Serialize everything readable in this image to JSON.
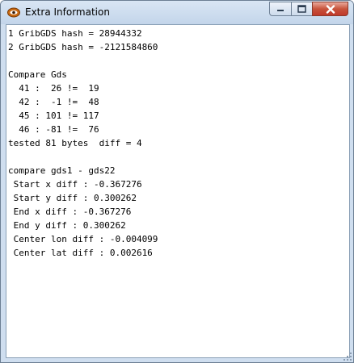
{
  "window": {
    "title": "Extra Information"
  },
  "log_lines": [
    "1 GribGDS hash = 28944332",
    "2 GribGDS hash = -2121584860",
    "",
    "Compare Gds",
    "  41 :  26 !=  19",
    "  42 :  -1 !=  48",
    "  45 : 101 != 117",
    "  46 : -81 !=  76",
    "tested 81 bytes  diff = 4",
    "",
    "compare gds1 - gds22",
    " Start x diff : -0.367276",
    " Start y diff : 0.300262",
    " End x diff : -0.367276",
    " End y diff : 0.300262",
    " Center lon diff : -0.004099",
    " Center lat diff : 0.002616"
  ],
  "icons": {
    "app": "eye-icon",
    "minimize": "minimize-icon",
    "maximize": "maximize-icon",
    "close": "close-icon"
  }
}
